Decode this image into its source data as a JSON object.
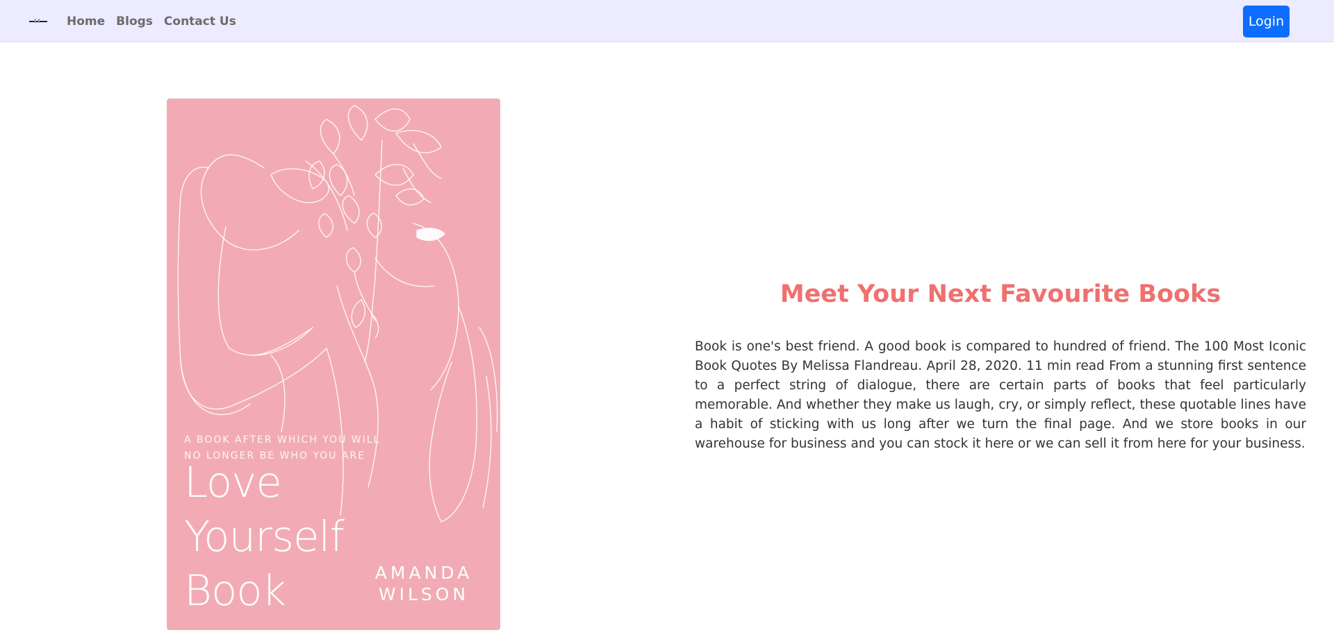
{
  "nav": {
    "brand_icon": "hamburger-logo-icon",
    "links": [
      {
        "label": "Home"
      },
      {
        "label": "Blogs"
      },
      {
        "label": "Contact Us"
      }
    ],
    "login_label": "Login",
    "colors": {
      "bar": "#ecebff",
      "login": "#0d6efd"
    }
  },
  "book": {
    "tagline": "A BOOK AFTER WHICH YOU WILL NO LONGER BE WHO YOU ARE",
    "title": "Love\nYourself\nBook",
    "author": "AMANDA\nWILSON",
    "colors": {
      "background": "#f2abb4",
      "line_art": "#ffffff"
    },
    "illustration": "line-art woman watering flowers"
  },
  "hero": {
    "heading": "Meet Your Next Favourite Books",
    "body": "Book is one's best friend. A good book is compared to hundred of friend. The 100 Most Iconic Book Quotes By Melissa Flandreau. April 28, 2020. 11 min read From a stunning first sentence to a perfect string of dialogue, there are certain parts of books that feel particularly memorable. And whether they make us laugh, cry, or simply reflect, these quotable lines have a habit of sticking with us long after we turn the final page. And we store books in our warehouse for business and you can stock it here or we can sell it from here for your business.",
    "colors": {
      "heading": "#f07070",
      "body": "#333333"
    }
  }
}
